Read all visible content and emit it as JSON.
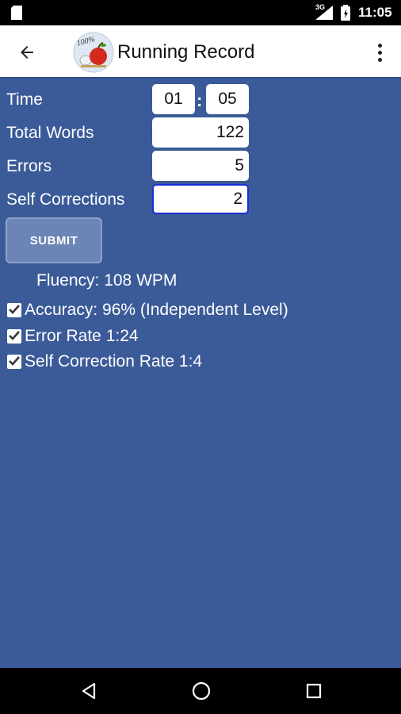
{
  "status_bar": {
    "time": "11:05",
    "network_label": "3G",
    "icons": [
      "sd-card-icon",
      "signal-icon",
      "battery-icon"
    ]
  },
  "app_bar": {
    "title": "Running Record",
    "logo_text": "100%"
  },
  "form": {
    "time_label": "Time",
    "time_minutes": "01",
    "time_separator": ":",
    "time_seconds": "05",
    "total_words_label": "Total Words",
    "total_words_value": "122",
    "errors_label": "Errors",
    "errors_value": "5",
    "self_corrections_label": "Self Corrections",
    "self_corrections_value": "2",
    "submit_label": "SUBMIT"
  },
  "results": {
    "fluency": "Fluency: 108 WPM",
    "accuracy": "Accuracy: 96% (Independent Level)",
    "error_rate": "Error Rate 1:24",
    "self_correction_rate": "Self Correction Rate 1:4"
  },
  "colors": {
    "background": "#3b5a98",
    "app_bar": "#ffffff",
    "focus_border": "#1a2fd6",
    "submit_button": "#6c84b6"
  }
}
